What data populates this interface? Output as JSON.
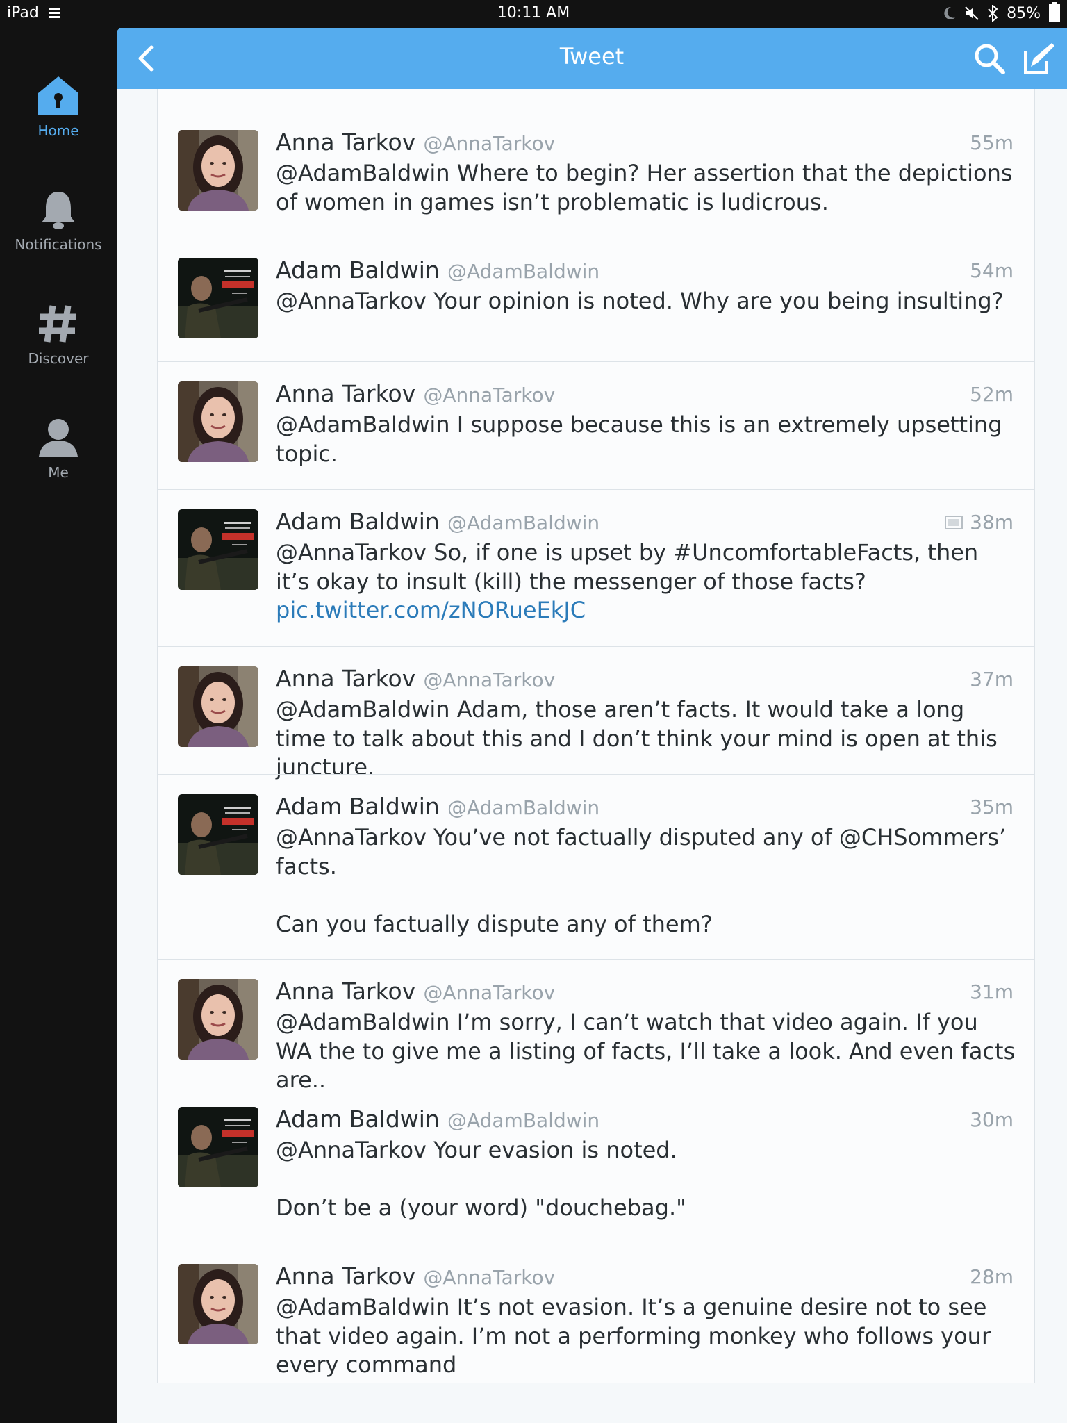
{
  "status_bar": {
    "device": "iPad",
    "time": "10:11 AM",
    "battery": "85%"
  },
  "nav": {
    "home": "Home",
    "notifications": "Notifications",
    "discover": "Discover",
    "me": "Me"
  },
  "header": {
    "title": "Tweet"
  },
  "colors": {
    "accent": "#55acee",
    "sidebar_bg": "#121212",
    "link": "#2b7bb9"
  },
  "tweets": [
    {
      "author": "anna",
      "name": "Anna Tarkov",
      "handle": "@AnnaTarkov",
      "time": "55m",
      "text": "@AdamBaldwin Where to begin? Her assertion that the depictions of women in games isn’t problematic is ludicrous."
    },
    {
      "author": "adam",
      "name": "Adam Baldwin",
      "handle": "@AdamBaldwin",
      "time": "54m",
      "text": "@AnnaTarkov Your opinion is noted. Why are you being insulting?"
    },
    {
      "author": "anna",
      "name": "Anna Tarkov",
      "handle": "@AnnaTarkov",
      "time": "52m",
      "text": "@AdamBaldwin I suppose because this is an extremely upsetting topic."
    },
    {
      "author": "adam",
      "name": "Adam Baldwin",
      "handle": "@AdamBaldwin",
      "time": "38m",
      "has_photo": true,
      "text": "@AnnaTarkov So, if one is upset by #UncomfortableFacts, then it’s okay to insult (kill) the messenger of those facts? ",
      "link": "pic.twitter.com/zNORueEkJC"
    },
    {
      "author": "anna",
      "name": "Anna Tarkov",
      "handle": "@AnnaTarkov",
      "time": "37m",
      "text": "@AdamBaldwin Adam, those aren’t facts. It would take a long time to talk about this and I don’t think your mind is open at this juncture."
    },
    {
      "author": "adam",
      "name": "Adam Baldwin",
      "handle": "@AdamBaldwin",
      "time": "35m",
      "text": "@AnnaTarkov You’ve not factually disputed any of @CHSommers’ facts.\n\nCan you factually dispute any of them?"
    },
    {
      "author": "anna",
      "name": "Anna Tarkov",
      "handle": "@AnnaTarkov",
      "time": "31m",
      "text": "@AdamBaldwin I’m sorry, I can’t watch that video again. If you WA the to give me a listing of facts, I’ll take a look. And even facts are.."
    },
    {
      "author": "adam",
      "name": "Adam Baldwin",
      "handle": "@AdamBaldwin",
      "time": "30m",
      "text": "@AnnaTarkov Your evasion is noted.\n\nDon’t be a (your word) \"douchebag.\""
    },
    {
      "author": "anna",
      "name": "Anna Tarkov",
      "handle": "@AnnaTarkov",
      "time": "28m",
      "text": "@AdamBaldwin It’s not evasion. It’s a genuine desire not to see that video again. I’m not a performing monkey who follows your every command"
    }
  ]
}
